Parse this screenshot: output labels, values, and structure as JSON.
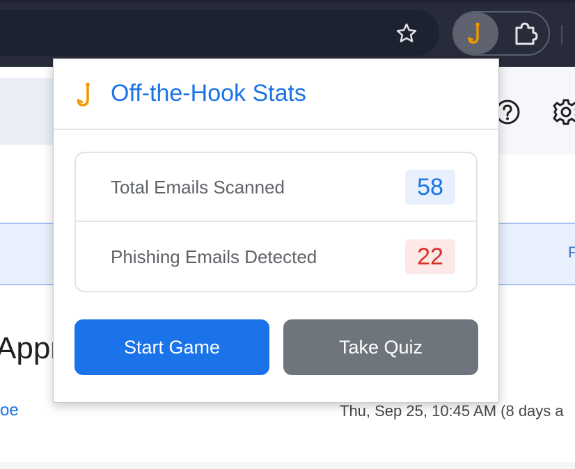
{
  "popup": {
    "title": "Off-the-Hook Stats",
    "stats": [
      {
        "label": "Total Emails Scanned",
        "value": "58"
      },
      {
        "label": "Phishing Emails Detected",
        "value": "22"
      }
    ],
    "buttons": {
      "start_game": "Start Game",
      "take_quiz": "Take Quiz"
    }
  },
  "background_page": {
    "subject_fragment": "Appr",
    "sender_fragment": "oe",
    "date": "Thu, Sep 25, 10:45 AM (8 days a",
    "banner_right_fragment": "P"
  },
  "colors": {
    "accent": "#1a73e8",
    "danger": "#d93025",
    "secondary_button": "#6f757c",
    "hook_icon": "#f29900"
  },
  "icons": {
    "toolbar": [
      "star-icon",
      "hook-extension-icon",
      "puzzle-icon"
    ],
    "page": [
      "help-icon",
      "settings-icon"
    ],
    "popup": [
      "hook-logo-icon"
    ]
  }
}
